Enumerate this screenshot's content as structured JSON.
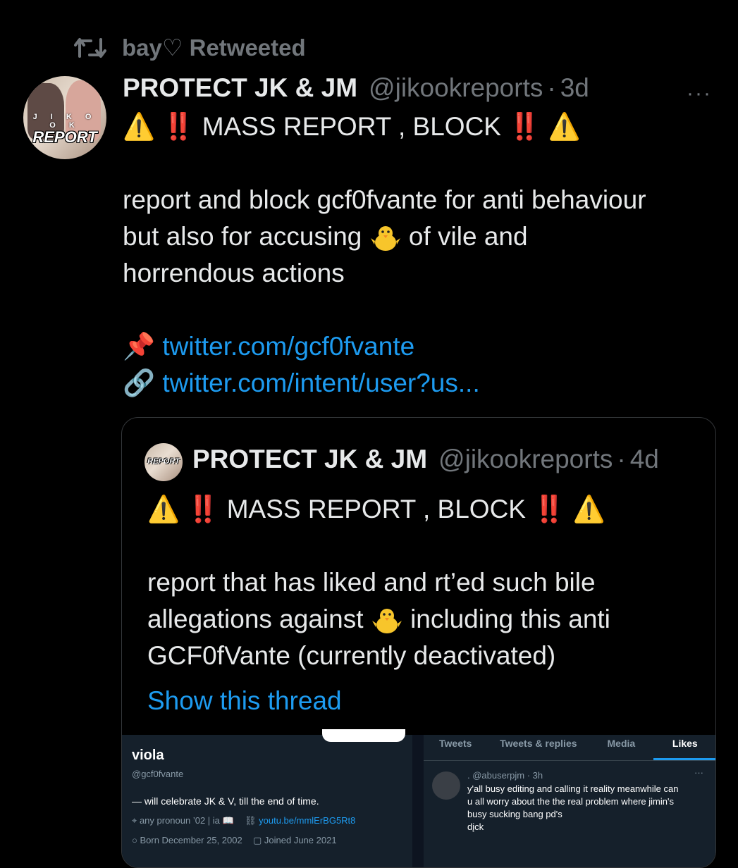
{
  "retweet": {
    "icon": "retweet-icon",
    "text": "bay♡ Retweeted"
  },
  "tweet": {
    "name": "PROTECT JK & JM",
    "handle": "@jikookreports",
    "dot": "·",
    "time": "3d",
    "more": "···",
    "avatar_small": "J I K O O K",
    "avatar_big": "REPORT",
    "headline": "MASS REPORT , BLOCK",
    "warn": "⚠️",
    "bangs": "‼️",
    "body_line1": "report and block gcf0fvante for anti behaviour",
    "body_line2a": "but also for accusing",
    "body_line2b": "of vile and",
    "body_line3": "horrendous actions",
    "pin": "📌",
    "link1": "twitter.com/gcf0fvante",
    "chain": "🔗",
    "link2": "twitter.com/intent/user?us..."
  },
  "quote": {
    "name": "PROTECT JK & JM",
    "handle": "@jikookreports",
    "dot": "·",
    "time": "4d",
    "avatar_big": "REPORT",
    "headline": "MASS REPORT , BLOCK",
    "body_line1": "report that has liked and rt’ed such bile",
    "body_line2a": "allegations against",
    "body_line2b": "including this anti",
    "body_line3": "GCF0fVante (currently deactivated)",
    "show_thread": "Show this thread"
  },
  "screenshot": {
    "profile": {
      "name": "viola",
      "handle": "@gcf0fvante",
      "bio": "— will celebrate JK & V, till the end of time.",
      "pronoun": "any pronoun ’02 | ia 📖",
      "link": "youtu.be/mmlErBG5Rt8",
      "born": "Born December 25, 2002",
      "joined": "Joined June 2021"
    },
    "tabs": [
      "Tweets",
      "Tweets & replies",
      "Media",
      "Likes"
    ],
    "liked": {
      "user": ". @abuserpjm · 3h",
      "more": "···",
      "text1": "y'all busy editing and calling it reality meanwhile can",
      "text2": "u all worry about the the real problem where jimin's",
      "text3": "busy sucking bang pd's",
      "text4": "dįck"
    }
  },
  "colors": {
    "link": "#1d9bf0",
    "muted": "#71767b",
    "bg": "#000000"
  }
}
